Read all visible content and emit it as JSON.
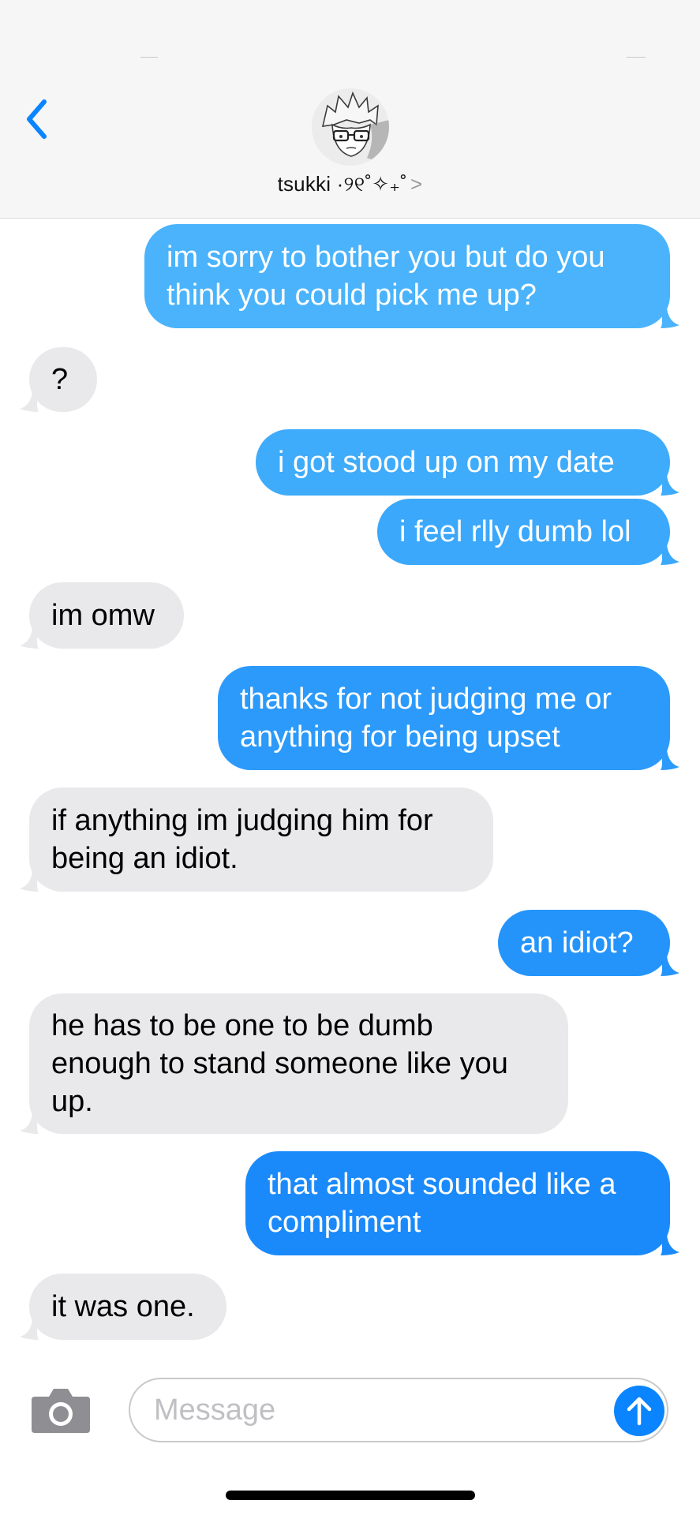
{
  "header": {
    "contact_name": "tsukki ·୨୧˚✧₊˚",
    "chevron": ">",
    "accent_color": "#0a84ff",
    "icons": [
      "chevron-left-icon",
      "avatar"
    ]
  },
  "messages": [
    {
      "id": "m1",
      "from": "me",
      "text": "im sorry to bother you but do you\nthink you could pick me up?",
      "color": "#4ab3fb"
    },
    {
      "id": "m2",
      "from": "them",
      "text": "?"
    },
    {
      "id": "m3",
      "from": "me",
      "text": "i got stood up on my date",
      "color": "#3fabfb"
    },
    {
      "id": "m4",
      "from": "me",
      "text": "i feel rlly dumb lol",
      "color": "#3ca8fb"
    },
    {
      "id": "m5",
      "from": "them",
      "text": "im omw"
    },
    {
      "id": "m6",
      "from": "me",
      "text": "thanks for not judging me or\nanything for being upset",
      "color": "#2b9afb"
    },
    {
      "id": "m7",
      "from": "them",
      "text": "if anything im judging him for\nbeing an idiot."
    },
    {
      "id": "m8",
      "from": "me",
      "text": "an idiot?",
      "color": "#2494fb"
    },
    {
      "id": "m9",
      "from": "them",
      "text": "he has to be one to be dumb\nenough to stand someone like you\nup."
    },
    {
      "id": "m10",
      "from": "me",
      "text": "that almost sounded like a\ncompliment",
      "color": "#1a8afb"
    },
    {
      "id": "m11",
      "from": "them",
      "text": "it was one."
    }
  ],
  "compose": {
    "placeholder": "Message",
    "value": "",
    "icons": [
      "camera-icon",
      "arrow-up-icon"
    ]
  }
}
